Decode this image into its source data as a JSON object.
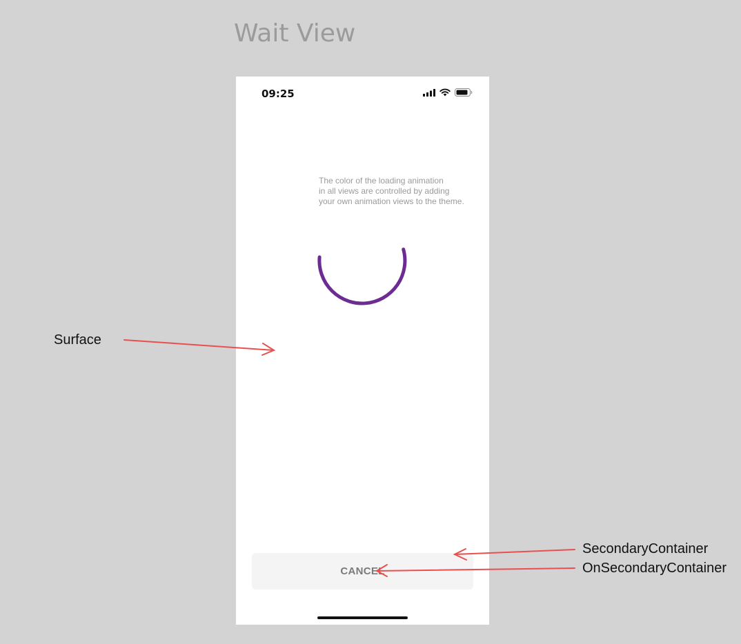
{
  "page": {
    "title": "Wait View"
  },
  "status_bar": {
    "time": "09:25",
    "icons": [
      "cellular-signal-icon",
      "wifi-icon",
      "battery-icon"
    ]
  },
  "content": {
    "info_text": "The color of the loading animation\nin all views are controlled by adding\nyour own animation views to the theme.",
    "spinner_color": "#6c2c91"
  },
  "footer": {
    "cancel_label": "CANCEL"
  },
  "annotations": {
    "surface": "Surface",
    "secondary_container": "SecondaryContainer",
    "on_secondary_container": "OnSecondaryContainer",
    "arrow_color": "#e8504f"
  }
}
